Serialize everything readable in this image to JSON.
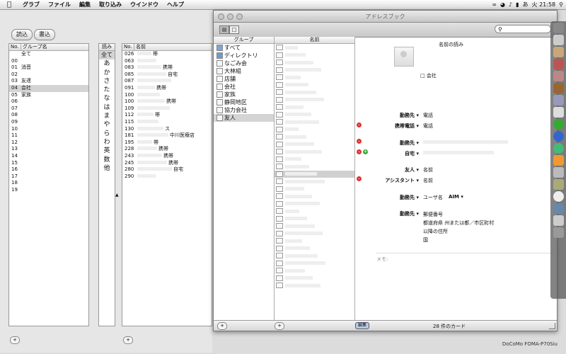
{
  "menubar": {
    "items": [
      "グラブ",
      "ファイル",
      "編集",
      "取り込み",
      "ウインドウ",
      "ヘルプ"
    ],
    "clock": "火 21:58",
    "ime": "あ"
  },
  "left_app": {
    "read_button": "読込",
    "write_button": "書込",
    "group_header": {
      "no": "No.",
      "name": "グループ名"
    },
    "groups": [
      {
        "no": "",
        "name": "全て"
      },
      {
        "no": "00",
        "name": ""
      },
      {
        "no": "01",
        "name": "消音"
      },
      {
        "no": "02",
        "name": ""
      },
      {
        "no": "03",
        "name": "友達"
      },
      {
        "no": "04",
        "name": "会社"
      },
      {
        "no": "05",
        "name": "家族"
      },
      {
        "no": "06",
        "name": ""
      },
      {
        "no": "07",
        "name": ""
      },
      {
        "no": "08",
        "name": ""
      },
      {
        "no": "09",
        "name": ""
      },
      {
        "no": "10",
        "name": ""
      },
      {
        "no": "11",
        "name": ""
      },
      {
        "no": "12",
        "name": ""
      },
      {
        "no": "13",
        "name": ""
      },
      {
        "no": "14",
        "name": ""
      },
      {
        "no": "15",
        "name": ""
      },
      {
        "no": "16",
        "name": ""
      },
      {
        "no": "17",
        "name": ""
      },
      {
        "no": "18",
        "name": ""
      },
      {
        "no": "19",
        "name": ""
      }
    ],
    "kana_header": "読み",
    "kana": [
      "全て",
      "あ",
      "か",
      "さ",
      "た",
      "な",
      "は",
      "ま",
      "や",
      "ら",
      "わ",
      "英",
      "数",
      "他"
    ],
    "name_header": {
      "no": "No.",
      "name": "名前"
    },
    "names": [
      {
        "no": "026",
        "name": "帯"
      },
      {
        "no": "063",
        "name": ""
      },
      {
        "no": "083",
        "name": "携帯"
      },
      {
        "no": "085",
        "name": "自宅"
      },
      {
        "no": "087",
        "name": ""
      },
      {
        "no": "091",
        "name": "携帯"
      },
      {
        "no": "100",
        "name": ""
      },
      {
        "no": "100",
        "name": "携帯"
      },
      {
        "no": "109",
        "name": ""
      },
      {
        "no": "112",
        "name": "帯"
      },
      {
        "no": "115",
        "name": ""
      },
      {
        "no": "130",
        "name": "ス"
      },
      {
        "no": "181",
        "name": "中川医療店"
      },
      {
        "no": "195",
        "name": "帯"
      },
      {
        "no": "228",
        "name": "携帯"
      },
      {
        "no": "243",
        "name": "携帯"
      },
      {
        "no": "245",
        "name": "携帯"
      },
      {
        "no": "280",
        "name": "自宅"
      },
      {
        "no": "290",
        "name": ""
      }
    ]
  },
  "address_book": {
    "title": "アドレスブック",
    "group_header": "グループ",
    "name_header": "名前",
    "groups": [
      "すべて",
      "ディレクトリ",
      "なごみ会",
      "大林組",
      "店舗",
      "会社",
      "家族",
      "静岡地区",
      "協力会社",
      "友人"
    ],
    "selected_group": "友人",
    "detail": {
      "name_reading": "名前の読み",
      "company_checkbox": "会社",
      "phone_label": "勤務先",
      "phone_value": "電話",
      "mobile_label": "携帯電話",
      "mobile_value": "電話",
      "email_work_label": "勤務先",
      "email_home_label": "自宅",
      "friend_label": "友人",
      "friend_value": "名前",
      "assistant_label": "アシスタント",
      "assistant_value": "名前",
      "im_label": "勤務先",
      "im_value": "ユーザ名",
      "im_service": "AIM",
      "address_label": "勤務先",
      "address_lines": [
        "郵便番号",
        "都道府県 州または都／市区町村",
        "以降の住所",
        "国"
      ],
      "memo_label": "メモ:"
    },
    "edit_button": "編集",
    "card_count": "28 件のカード"
  },
  "status_text": "DoCoMo FOMA-P70Siu"
}
